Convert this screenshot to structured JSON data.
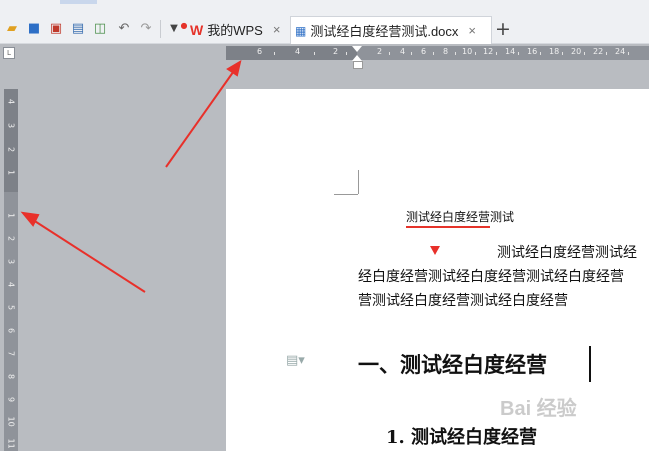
{
  "toolbar": {
    "tabs": [
      {
        "label": "我的WPS",
        "icon": "wps-logo-icon"
      },
      {
        "label": "测试经白度经营测试.docx",
        "icon": "docx-file-icon"
      }
    ],
    "close_glyph": "×",
    "new_tab_glyph": "+"
  },
  "horizontal_ruler": {
    "labels": [
      "6",
      "4",
      "2",
      "2",
      "4",
      "6",
      "8",
      "10",
      "12",
      "14",
      "16",
      "18",
      "20",
      "22",
      "24"
    ]
  },
  "vertical_ruler": {
    "labels": [
      "4",
      "3",
      "2",
      "1",
      "1",
      "2",
      "3",
      "4",
      "5",
      "6",
      "7",
      "8",
      "9",
      "10",
      "11"
    ]
  },
  "document": {
    "title": "测试经白度经营测试",
    "para_line1": "测试经白度经营测试经",
    "para_line2": "经白度经营测试经白度经营测试经白度经营",
    "para_line3": "营测试经白度经营测试经白度经营",
    "heading1": "一、测试经白度经营",
    "heading2": "1. 测试经白度经营"
  },
  "watermark": "Bai 经验",
  "colors": {
    "accent_red": "#e5332a",
    "background": "#b9bcc1",
    "page": "#ffffff",
    "ruler": "#8f939a"
  }
}
